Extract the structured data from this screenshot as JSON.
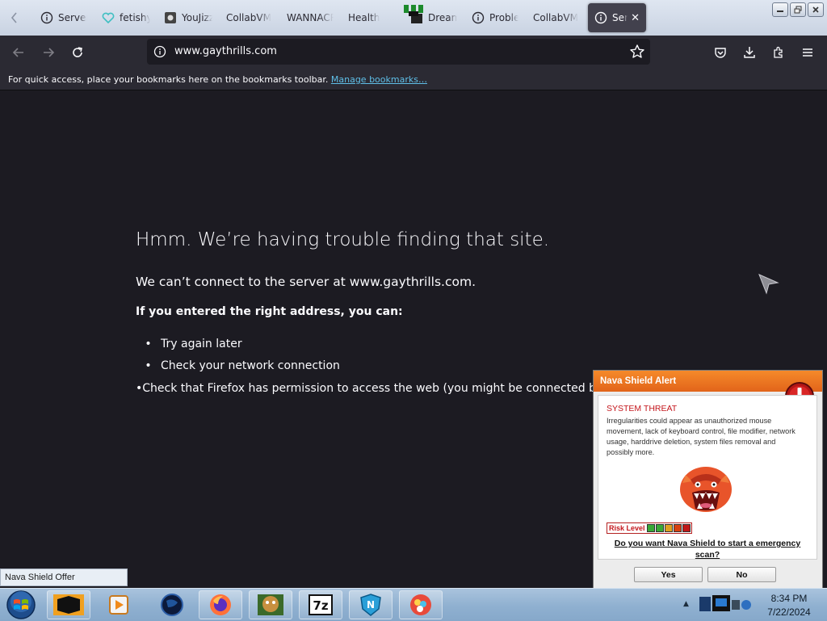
{
  "browser": {
    "tabs": [
      {
        "label": "Server Not Found",
        "icon": "info-icon"
      },
      {
        "label": "fetishy",
        "icon": "heart-icon"
      },
      {
        "label": "YouJizz",
        "icon": "site-favicon-icon"
      },
      {
        "label": "CollabVM",
        "icon": "none"
      },
      {
        "label": "WANNACRY",
        "icon": "none"
      },
      {
        "label": "Health",
        "icon": "none"
      },
      {
        "label": "Dream",
        "icon": "dark-favicon-icon"
      },
      {
        "label": "Problem",
        "icon": "info-icon"
      },
      {
        "label": "CollabVM",
        "icon": "none"
      },
      {
        "label": "Server Not Found",
        "icon": "info-icon",
        "active": true
      }
    ],
    "url": "www.gaythrills.com",
    "bookmarks_hint": "For quick access, place your bookmarks here on the bookmarks toolbar.",
    "bookmarks_link": "Manage bookmarks…"
  },
  "error_page": {
    "title": "Hmm. We’re having trouble finding that site.",
    "subtitle": "We can’t connect to the server at www.gaythrills.com.",
    "hint": "If you entered the right address, you can:",
    "suggestions": [
      "Try again later",
      "Check your network connection",
      "Check that Firefox has permission to access the web (you might be connected but behind a firewall)"
    ]
  },
  "nava_shield": {
    "header": "Nava Shield Alert",
    "threat_title": "SYSTEM THREAT",
    "description": "Irregularities could appear as unauthorized mouse movement, lack of keyboard control, file modifier, network usage, harddrive deletion, system files removal and possibly more.",
    "risk_label": "Risk Level",
    "risk_segments": [
      "#3aa835",
      "#3aa835",
      "#e0a020",
      "#d84010",
      "#c01818"
    ],
    "question": "Do you want Nava Shield to start a emergency scan?",
    "yes_label": "Yes",
    "no_label": "No",
    "offer_tooltip": "Nava Shield Offer",
    "accent_color": "#ee7a24"
  },
  "taskbar": {
    "apps": [
      "media-center-icon",
      "media-player-icon",
      "globe-icon",
      "firefox-icon",
      "bonzi-box-icon",
      "7zip-icon",
      "nava-shield-icon",
      "popcorn-icon"
    ],
    "time": "8:34 PM",
    "date": "7/22/2024"
  }
}
